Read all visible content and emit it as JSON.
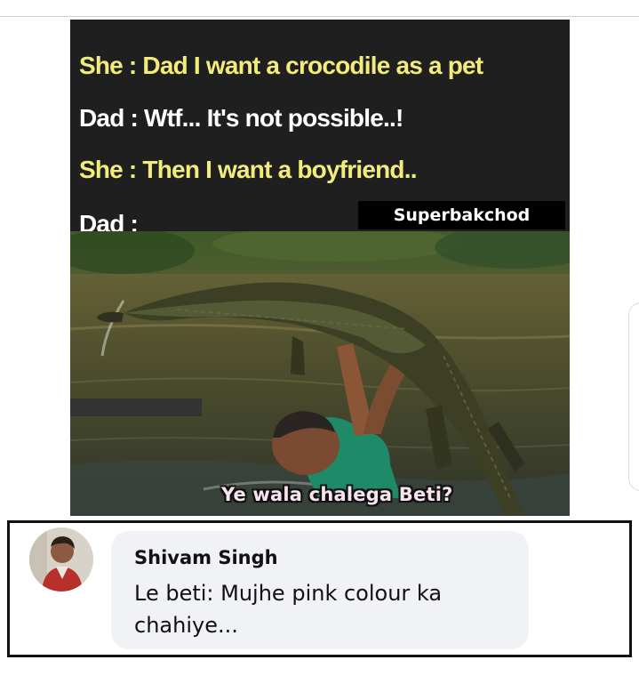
{
  "meme": {
    "lines": [
      "She : Dad I want a crocodile as a pet",
      "Dad : Wtf... It's not possible..!",
      "She : Then I want a boyfriend..",
      "Dad :"
    ],
    "watermark": "Superbakchod",
    "caption": "Ye wala chalega Beti?"
  },
  "comment": {
    "author": "Shivam Singh",
    "text": "Le beti: Mujhe pink colour ka chahiye..."
  },
  "colors": {
    "meme_yellow": "#f1ec7b",
    "meme_background": "#1f1f1f",
    "bubble_background": "#f0f2f5"
  }
}
